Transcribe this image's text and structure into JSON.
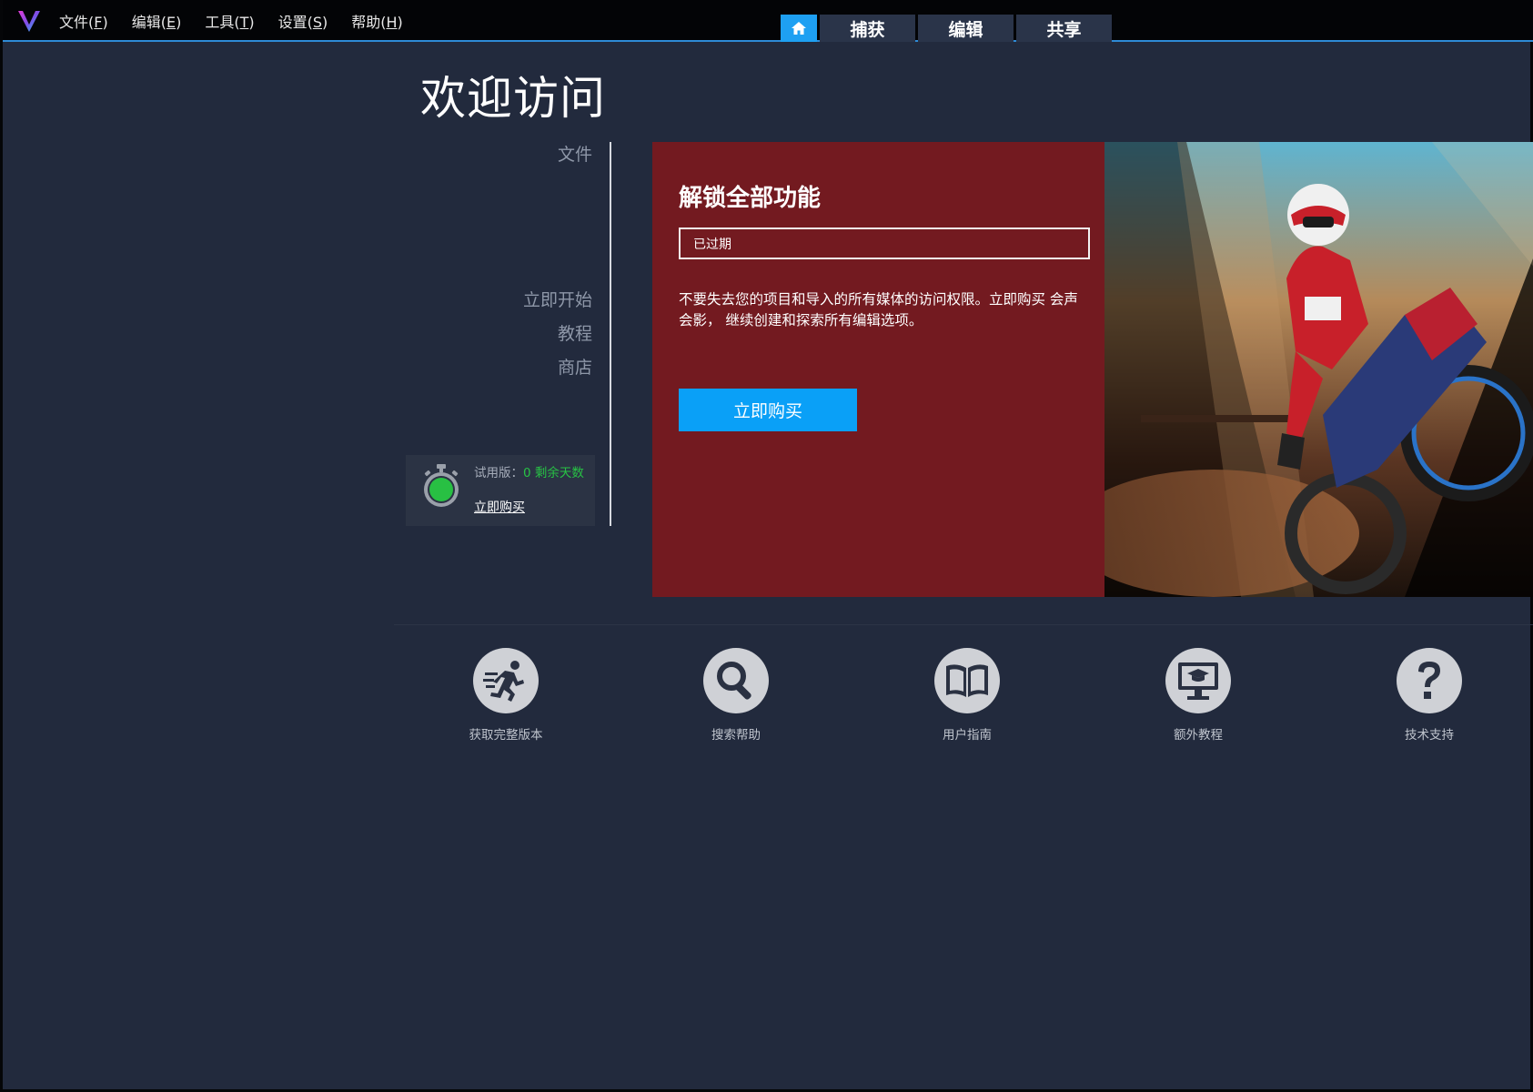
{
  "menu": {
    "items": [
      {
        "label": "文件(",
        "hotkey": "F",
        "suffix": ")"
      },
      {
        "label": "编辑(",
        "hotkey": "E",
        "suffix": ")"
      },
      {
        "label": "工具(",
        "hotkey": "T",
        "suffix": ")"
      },
      {
        "label": "设置(",
        "hotkey": "S",
        "suffix": ")"
      },
      {
        "label": "帮助(",
        "hotkey": "H",
        "suffix": ")"
      }
    ]
  },
  "tabs": {
    "home_icon": "home-icon",
    "capture": "捕获",
    "edit": "编辑",
    "share": "共享"
  },
  "page": {
    "title": "欢迎访问"
  },
  "leftnav": {
    "file": "文件",
    "start": "立即开始",
    "tutorial": "教程",
    "store": "商店"
  },
  "trial": {
    "prefix": "试用版：",
    "days_left": "0 剩余天数",
    "buy_link": "立即购买"
  },
  "promo": {
    "heading": "解锁全部功能",
    "status": "已过期",
    "description": "不要失去您的项目和导入的所有媒体的访问权限。立即购买 会声会影， 继续创建和探索所有编辑选项。",
    "buy_button": "立即购买"
  },
  "quick_links": [
    {
      "label": "获取完整版本",
      "icon": "runner-icon"
    },
    {
      "label": "搜索帮助",
      "icon": "search-icon"
    },
    {
      "label": "用户指南",
      "icon": "book-icon"
    },
    {
      "label": "额外教程",
      "icon": "monitor-graduation-icon"
    },
    {
      "label": "技术支持",
      "icon": "question-icon"
    }
  ],
  "colors": {
    "background": "#222a3d",
    "topbar": "#030406",
    "accent_blue": "#1ea0f2",
    "promo_red": "#731a20",
    "trial_green": "#27c244"
  }
}
